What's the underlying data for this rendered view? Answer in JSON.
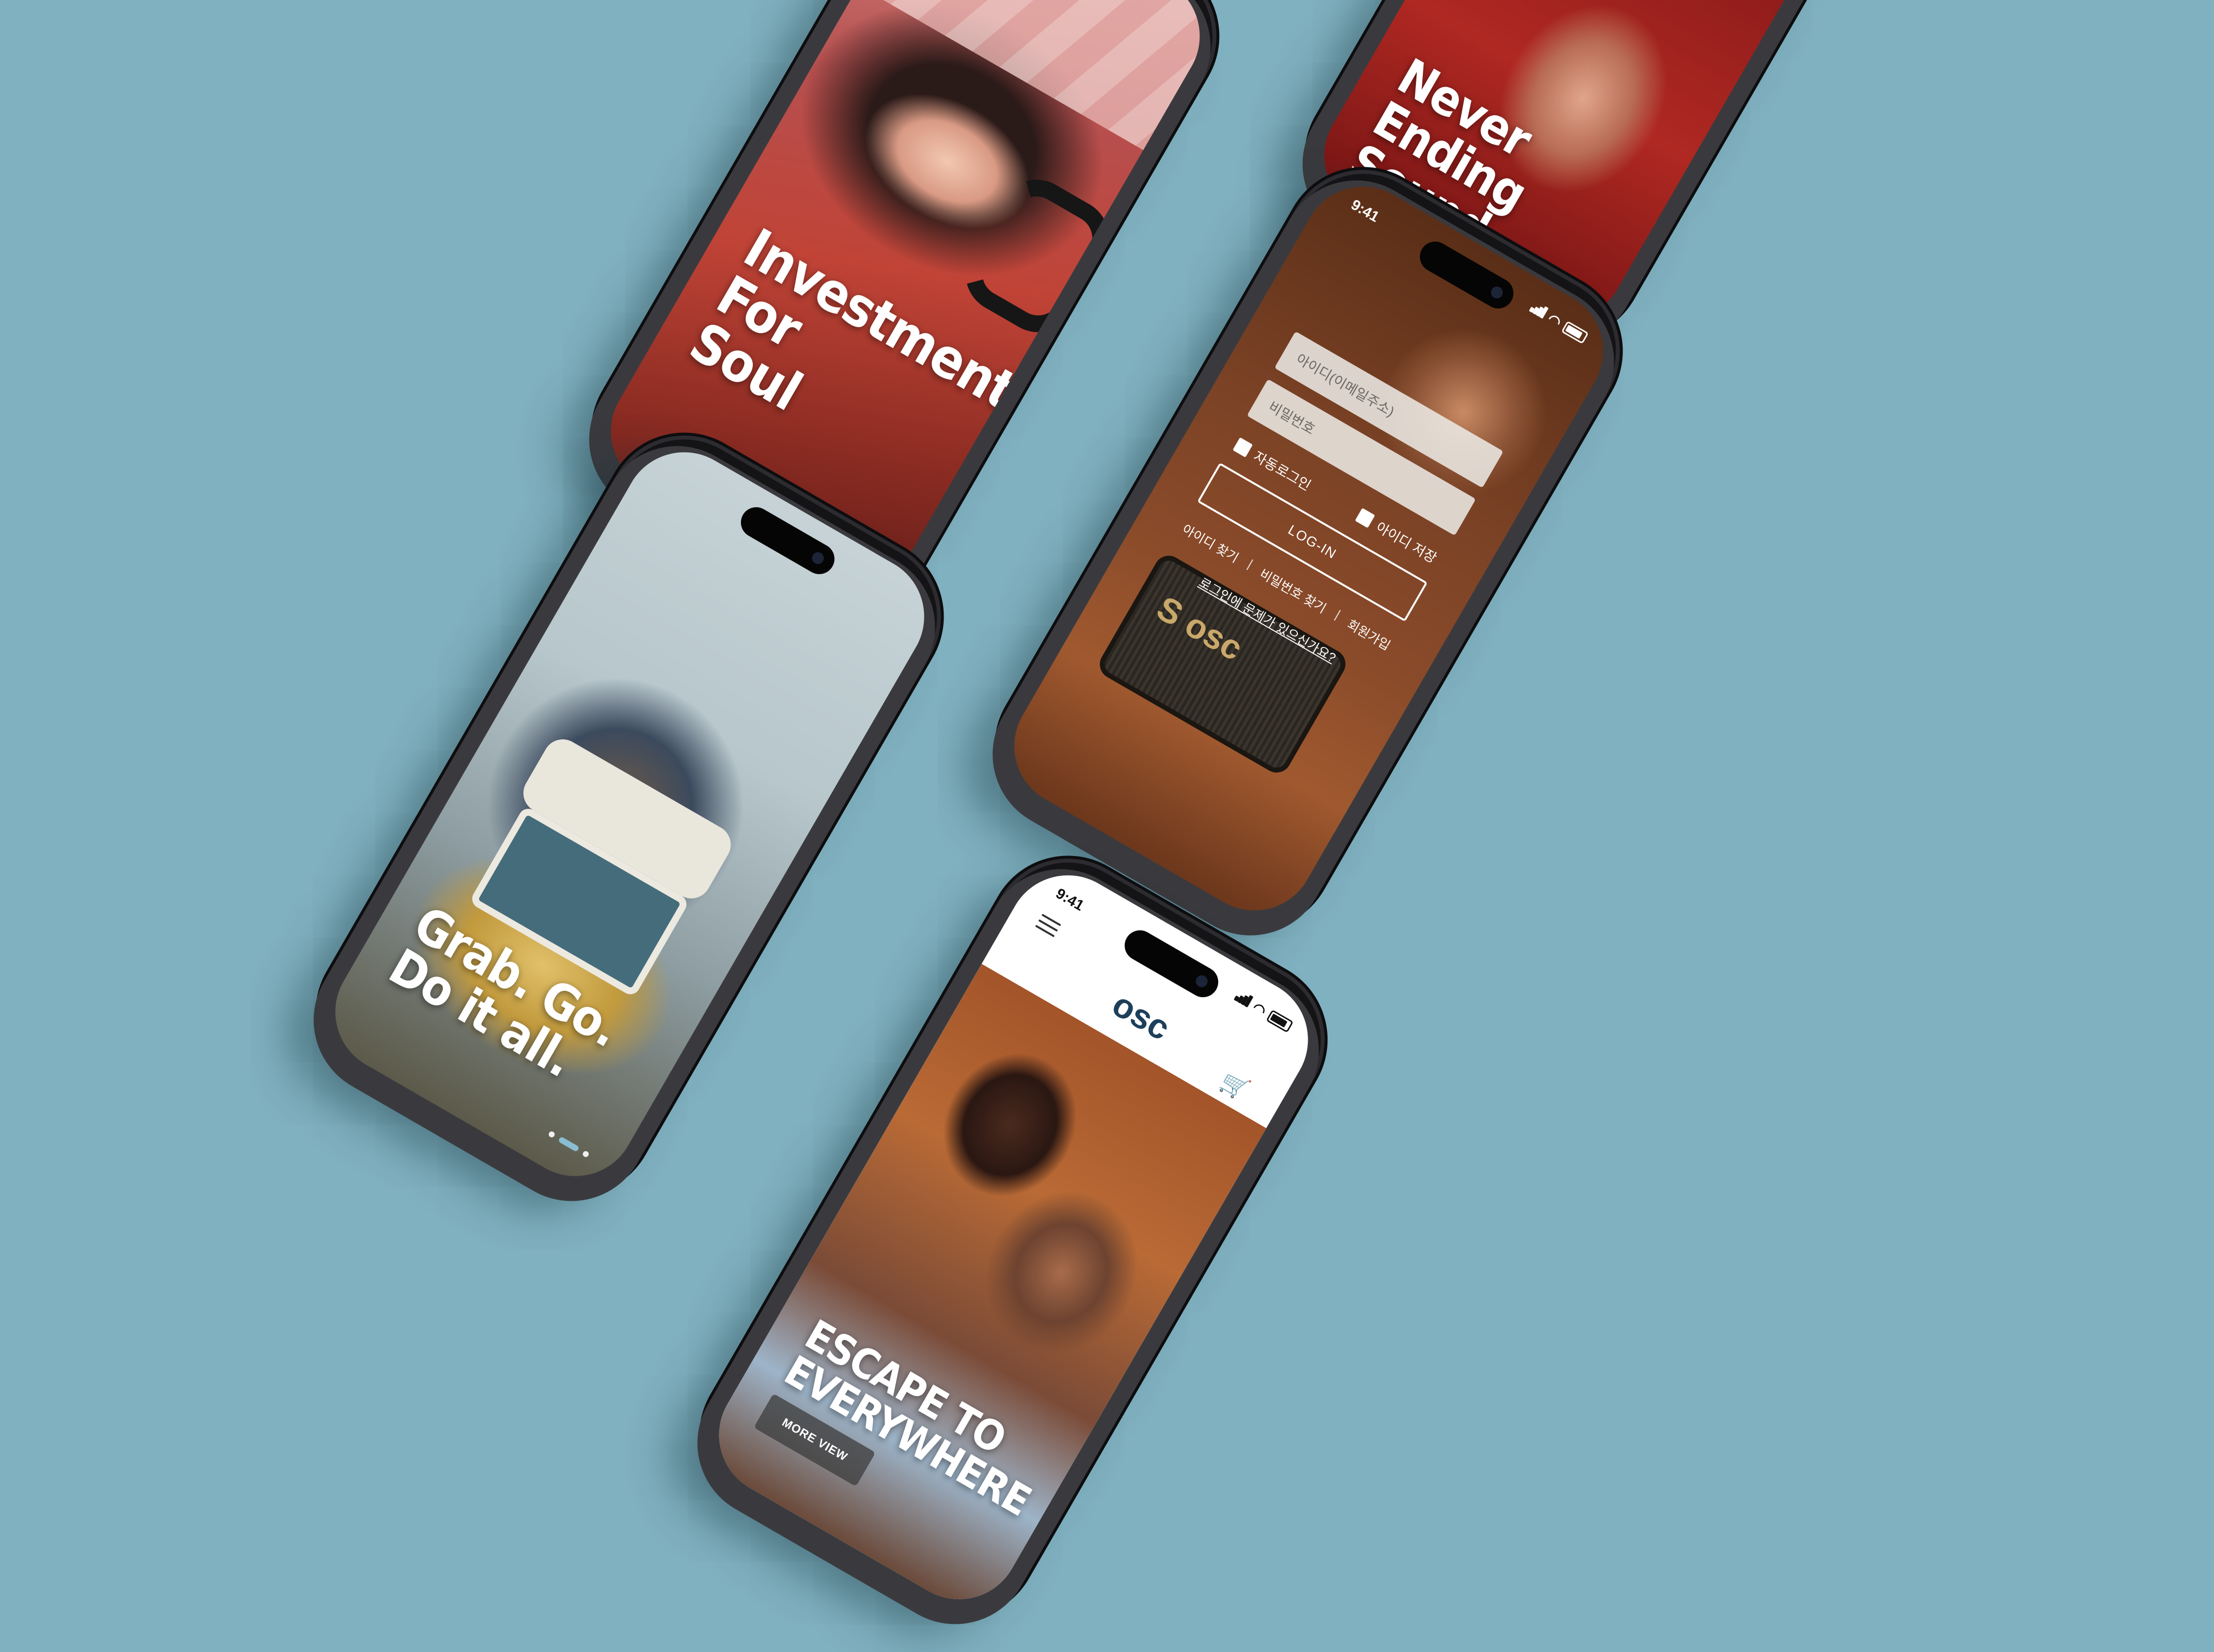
{
  "background_color": "#80b1c0",
  "accent_color": "#8fc6e0",
  "brand_color": "#1d3f5a",
  "phones": {
    "soul": {
      "headline": "Investment\nFor\nSoul",
      "carousel_active_index": 0,
      "carousel_count": 3
    },
    "sound": {
      "headline": "Never Ending\nSound",
      "carousel_active_index": 2,
      "carousel_count": 3
    },
    "login": {
      "status_time": "9:41",
      "id_placeholder": "아이디(이메일주소)",
      "password_placeholder": "비밀번호",
      "auto_login_label": "자동로그인",
      "save_id_label": "아이디 저장",
      "login_button": "LOG-IN",
      "find_id_link": "아이디 찾기",
      "find_password_link": "비밀번호 찾기",
      "signup_link": "회원가입",
      "separator": "|",
      "help_link": "로그인에 문제가 있으신가요?",
      "speaker_logo": "S osc"
    },
    "grab": {
      "headline": "Grab. Go.\nDo it all.",
      "carousel_active_index": 1,
      "carousel_count": 3
    },
    "escape": {
      "status_time": "9:41",
      "brand": "osc",
      "menu_icon": "hamburger-icon",
      "cart_icon": "cart-icon",
      "headline": "ESCAPE TO\nEVERYWHERE",
      "cta_button": "MORE VIEW"
    }
  }
}
